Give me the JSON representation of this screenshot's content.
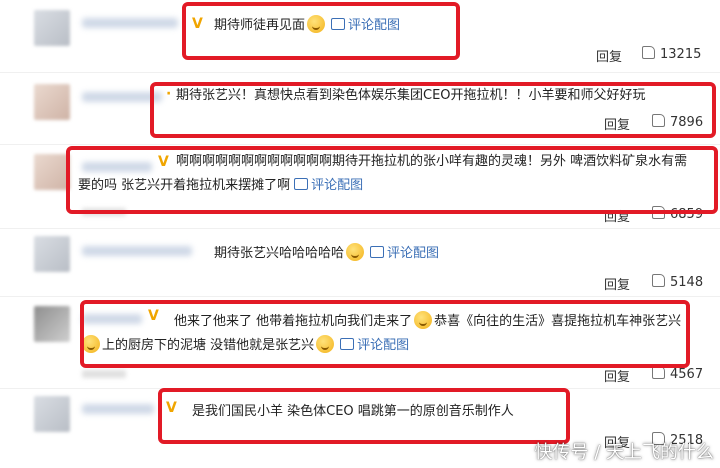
{
  "actions": {
    "reply_label": "回复",
    "pic_label": "评论配图"
  },
  "comments": [
    {
      "text": "期待师徒再见面",
      "likes": "13215"
    },
    {
      "text": "期待张艺兴！真想快点看到染色体娱乐集团CEO开拖拉机！！小羊要和师父好好玩",
      "likes": "7896"
    },
    {
      "text": "啊啊啊啊啊啊啊啊啊啊啊啊期待开拖拉机的张小咩有趣的灵魂！另外 啤酒饮料矿泉水有需要的吗 张艺兴开着拖拉机来摆摊了啊",
      "likes": "6859"
    },
    {
      "text": "期待张艺兴哈哈哈哈哈",
      "likes": "5148"
    },
    {
      "text_a": "他来了他来了 他带着拖拉机向我们走来了",
      "text_b": "恭喜《向往的生活》喜提拖拉机车神张艺兴",
      "text_c": "上的厨房下的泥塘 没错他就是张艺兴",
      "likes": "4567"
    },
    {
      "text": "是我们国民小羊 染色体CEO 唱跳第一的原创音乐制作人",
      "likes": "2518"
    }
  ],
  "watermark": "快传号 / 天上飞的什么",
  "colors": {
    "highlight_border": "#e21a26",
    "link": "#3b6fb6",
    "vip": "#f0a500"
  }
}
